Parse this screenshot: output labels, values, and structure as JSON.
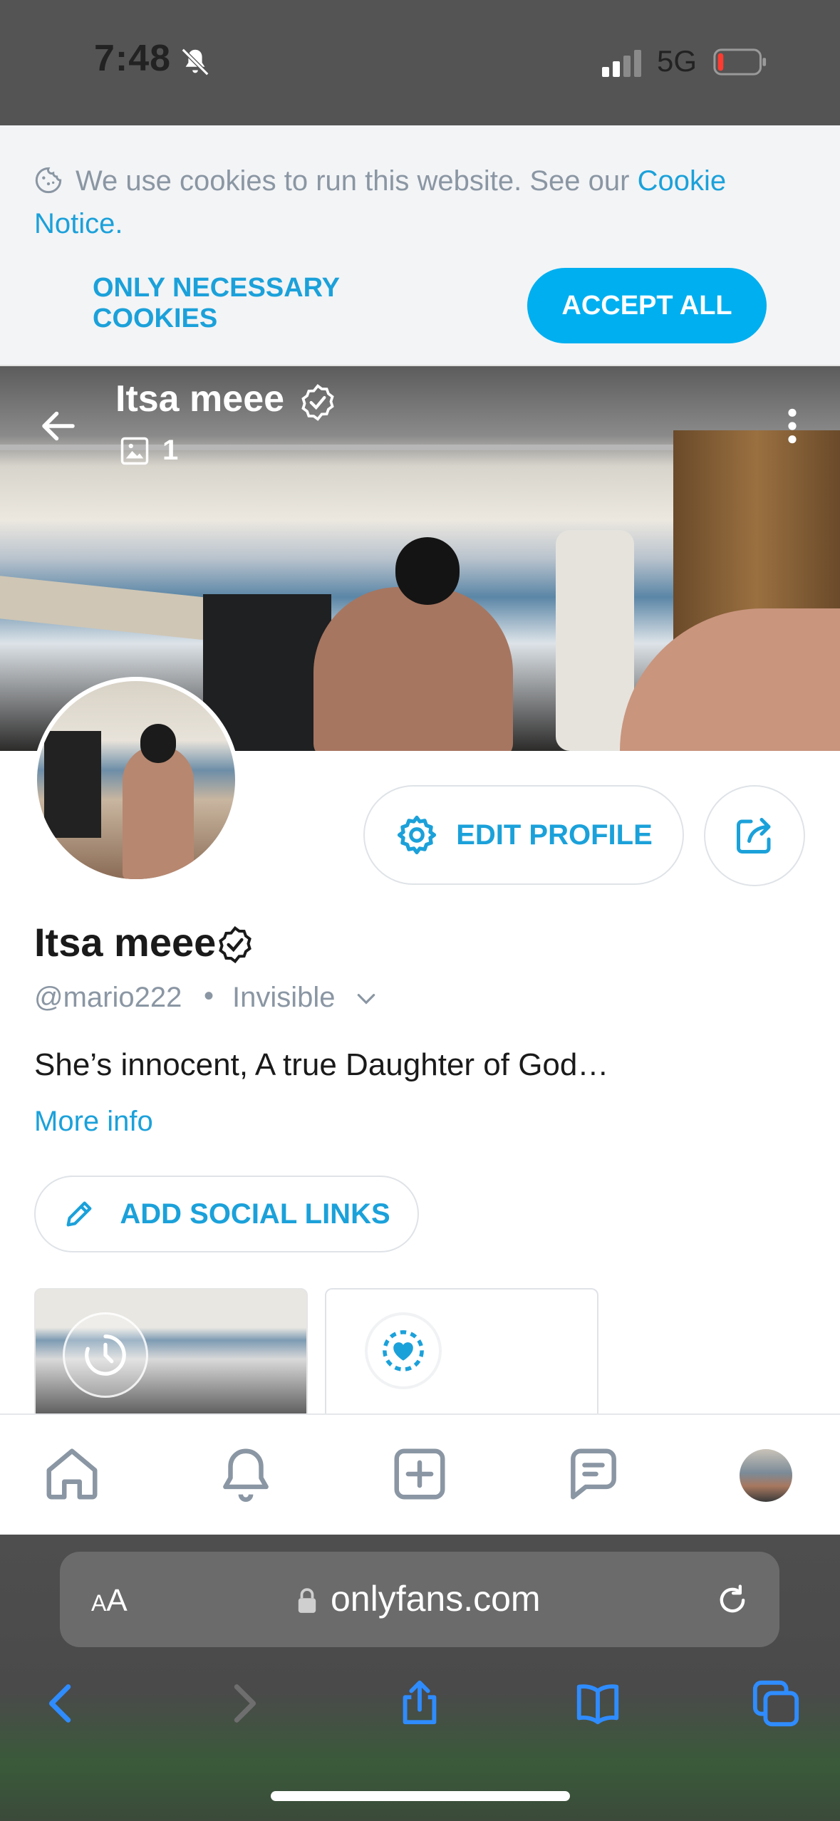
{
  "status_bar": {
    "time": "7:48",
    "network": "5G"
  },
  "cookie_banner": {
    "text": "We use cookies to run this website. See our ",
    "link_text": "Cookie Notice",
    "after_link": ".",
    "necessary_label": "ONLY NECESSARY COOKIES",
    "accept_label": "ACCEPT ALL"
  },
  "header": {
    "name": "Itsa meee",
    "media_count": "1"
  },
  "profile": {
    "edit_label": "EDIT PROFILE",
    "name": "Itsa meee",
    "handle": "@mario222",
    "separator": "•",
    "status": "Invisible",
    "bio": "She’s innocent, A true Daughter of God…",
    "more_info": "More info",
    "social_label": "ADD SOCIAL LINKS"
  },
  "browser": {
    "aa_small": "A",
    "aa_large": "A",
    "url": "onlyfans.com"
  },
  "colors": {
    "accent": "#00aff0",
    "link": "#1ba1da",
    "muted": "#8a96a3"
  },
  "icons": [
    "bell-slash-icon",
    "signal-icon",
    "battery-icon",
    "cookie-icon",
    "back-arrow-icon",
    "verified-icon",
    "image-icon",
    "more-vertical-icon",
    "gear-icon",
    "share-icon",
    "chevron-down-icon",
    "pencil-icon",
    "clock-icon",
    "heart-icon",
    "home-icon",
    "bell-icon",
    "add-post-icon",
    "messages-icon",
    "lock-icon",
    "reload-icon",
    "browser-back-icon",
    "browser-forward-icon",
    "browser-share-icon",
    "bookmarks-icon",
    "tabs-icon"
  ]
}
